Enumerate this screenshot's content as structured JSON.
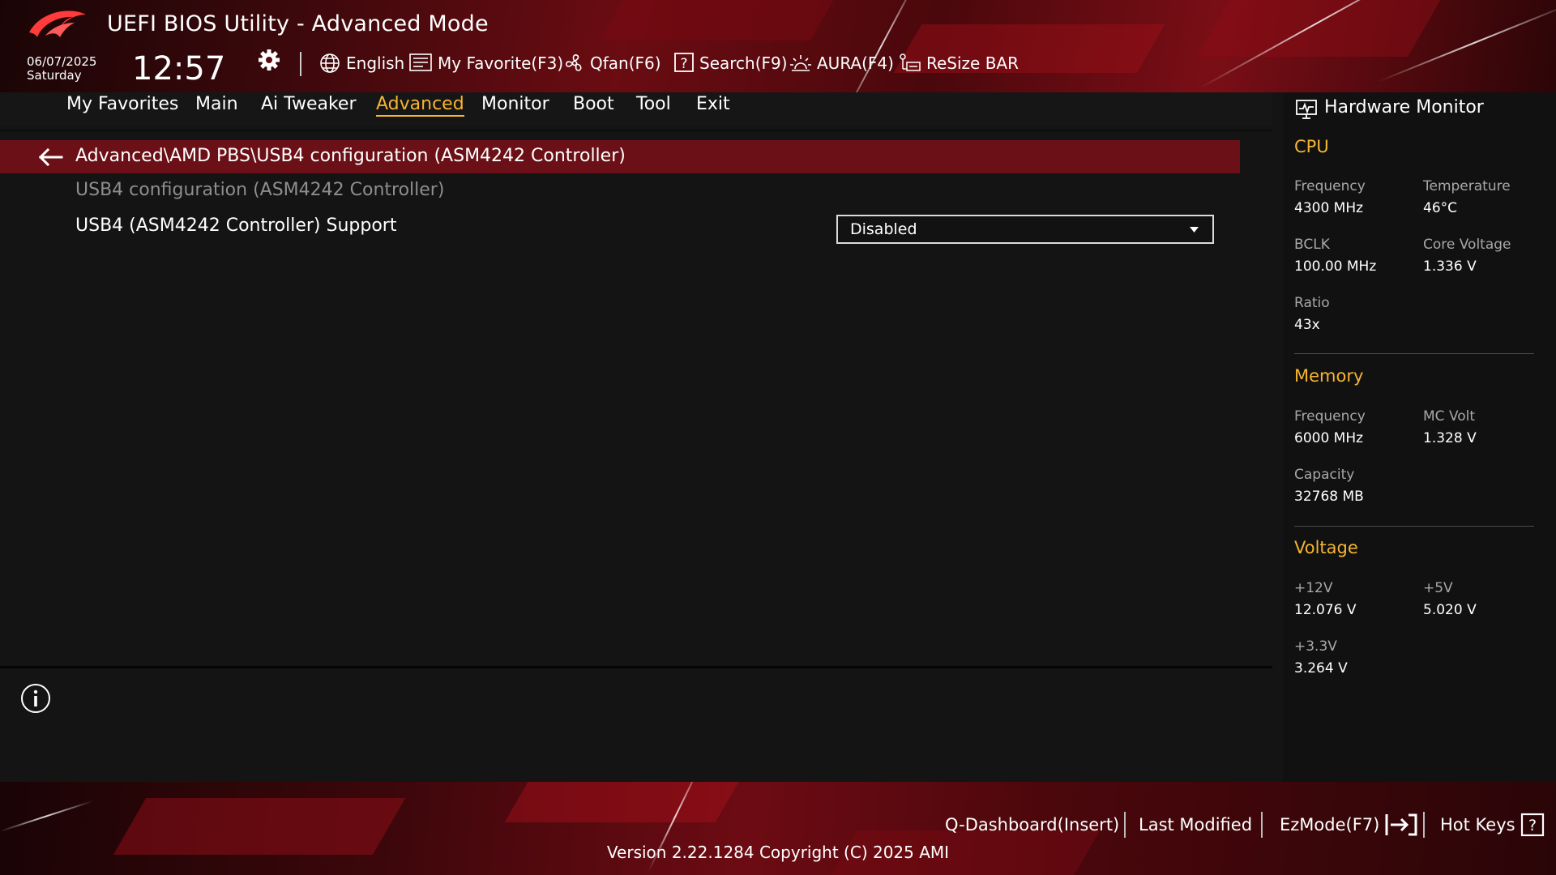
{
  "header": {
    "title": "UEFI BIOS Utility - Advanced Mode",
    "date": "06/07/2025",
    "day": "Saturday",
    "time": "12:57",
    "toolbar": [
      {
        "icon": "globe-icon",
        "label": "English"
      },
      {
        "icon": "favorite-list-icon",
        "label": "My Favorite(F3)"
      },
      {
        "icon": "fan-icon",
        "label": "Qfan(F6)"
      },
      {
        "icon": "question-box-icon",
        "label": "Search(F9)"
      },
      {
        "icon": "aura-lighting-icon",
        "label": "AURA(F4)"
      },
      {
        "icon": "resize-bar-icon",
        "label": "ReSize BAR"
      }
    ]
  },
  "nav": {
    "tabs": [
      "My Favorites",
      "Main",
      "Ai Tweaker",
      "Advanced",
      "Monitor",
      "Boot",
      "Tool",
      "Exit"
    ],
    "active": "Advanced"
  },
  "main": {
    "breadcrumb": "Advanced\\AMD PBS\\USB4 configuration (ASM4242 Controller)",
    "section_heading": "USB4 configuration (ASM4242 Controller)",
    "setting": {
      "label": "USB4 (ASM4242 Controller) Support",
      "value": "Disabled"
    }
  },
  "hardware_monitor": {
    "title": "Hardware Monitor",
    "cpu": {
      "title": "CPU",
      "frequency_label": "Frequency",
      "frequency": "4300 MHz",
      "temperature_label": "Temperature",
      "temperature": "46°C",
      "bclk_label": "BCLK",
      "bclk": "100.00 MHz",
      "core_voltage_label": "Core Voltage",
      "core_voltage": "1.336 V",
      "ratio_label": "Ratio",
      "ratio": "43x"
    },
    "memory": {
      "title": "Memory",
      "frequency_label": "Frequency",
      "frequency": "6000 MHz",
      "mc_volt_label": "MC Volt",
      "mc_volt": "1.328 V",
      "capacity_label": "Capacity",
      "capacity": "32768 MB"
    },
    "voltage": {
      "title": "Voltage",
      "v12_label": "+12V",
      "v12": "12.076 V",
      "v5_label": "+5V",
      "v5": "5.020 V",
      "v33_label": "+3.3V",
      "v33": "3.264 V"
    }
  },
  "footer": {
    "q_dashboard": "Q-Dashboard(Insert)",
    "last_modified": "Last Modified",
    "ezmode": "EzMode(F7)",
    "hot_keys": "Hot Keys",
    "version": "Version 2.22.1284 Copyright (C) 2025 AMI"
  },
  "colors": {
    "accent": "#f5b532",
    "breadcrumb_bar": "#6b1016",
    "header_red": "#6a0c12",
    "background": "#141414"
  }
}
